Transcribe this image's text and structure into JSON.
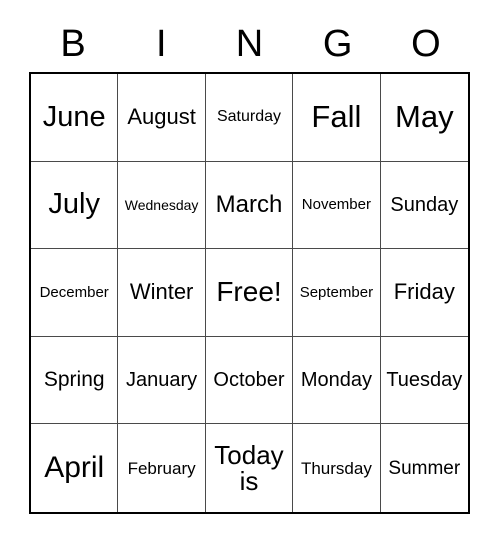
{
  "card": {
    "title": "BINGO",
    "header_letters": [
      "B",
      "I",
      "N",
      "G",
      "O"
    ],
    "free_space_label": "Free!",
    "grid": {
      "rows": 5,
      "columns": 5,
      "cells": [
        [
          {
            "text": "June",
            "size": "fs-28"
          },
          {
            "text": "August",
            "size": "fs-22"
          },
          {
            "text": "Saturday",
            "size": "fs-16"
          },
          {
            "text": "Fall",
            "size": "fs-30"
          },
          {
            "text": "May",
            "size": "fs-30"
          }
        ],
        [
          {
            "text": "July",
            "size": "fs-28"
          },
          {
            "text": "Wednesday",
            "size": "fs-14"
          },
          {
            "text": "March",
            "size": "fs-24"
          },
          {
            "text": "November",
            "size": "fs-15"
          },
          {
            "text": "Sunday",
            "size": "fs-20"
          }
        ],
        [
          {
            "text": "December",
            "size": "fs-15"
          },
          {
            "text": "Winter",
            "size": "fs-22"
          },
          {
            "text": "Free!",
            "size": "fs-27"
          },
          {
            "text": "September",
            "size": "fs-15"
          },
          {
            "text": "Friday",
            "size": "fs-22"
          }
        ],
        [
          {
            "text": "Spring",
            "size": "fs-21"
          },
          {
            "text": "January",
            "size": "fs-20"
          },
          {
            "text": "October",
            "size": "fs-20"
          },
          {
            "text": "Monday",
            "size": "fs-20"
          },
          {
            "text": "Tuesday",
            "size": "fs-20"
          }
        ],
        [
          {
            "text": "April",
            "size": "fs-29"
          },
          {
            "text": "February",
            "size": "fs-17"
          },
          {
            "text": "Today\nis",
            "size": "fs-26"
          },
          {
            "text": "Thursday",
            "size": "fs-17"
          },
          {
            "text": "Summer",
            "size": "fs-19"
          }
        ]
      ]
    },
    "colors": {
      "background": "#ffffff",
      "text": "#000000",
      "outer_border": "#000000",
      "inner_grid_line": "#4a4a4a"
    }
  }
}
